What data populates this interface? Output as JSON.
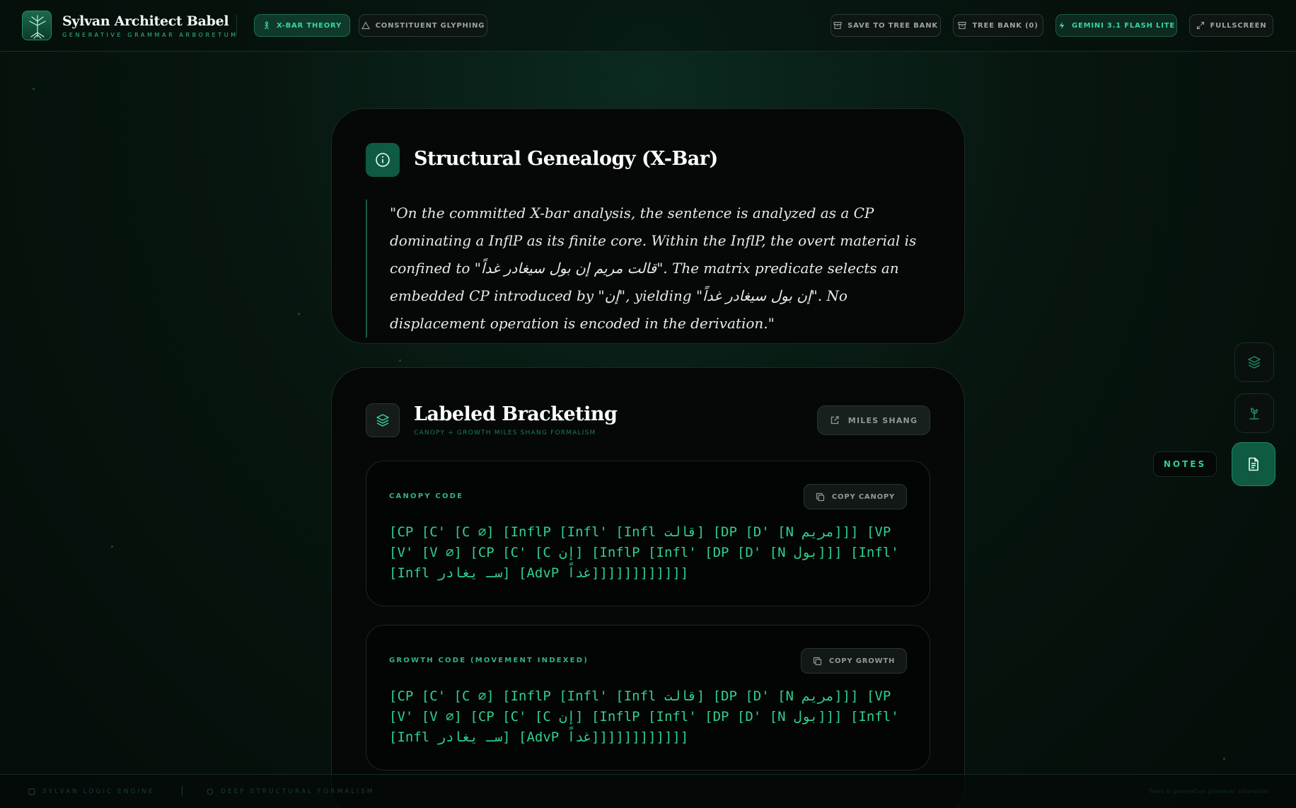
{
  "app": {
    "title": "Sylvan Architect Babel",
    "subtitle": "GENERATIVE GRAMMAR ARBORETUM"
  },
  "modes": {
    "xbar": "X-BAR THEORY",
    "glyphing": "CONSTITUENT GLYPHING"
  },
  "toolbar": {
    "save": "SAVE TO TREE BANK",
    "bank": "TREE BANK (0)",
    "model": "GEMINI 3.1 FLASH LITE",
    "fullscreen": "FULLSCREEN"
  },
  "genealogy": {
    "title": "Structural Genealogy (X-Bar)",
    "quote": "\"On the committed X-bar analysis, the sentence is analyzed as a CP dominating a InflP as its finite core. Within the InflP, the overt material is confined to \"قالت مريم إن بول سيغادر غداً\". The matrix predicate selects an embedded CP introduced by \"إن\", yielding \"إن بول سيغادر غداً\". No displacement operation is encoded in the derivation.\""
  },
  "bracketing": {
    "title": "Labeled Bracketing",
    "subtitle": "CANOPY + GROWTH MILES SHANG FORMALISM",
    "author_button": "MILES SHANG",
    "canopy": {
      "label": "CANOPY CODE",
      "copy": "COPY CANOPY",
      "code": "[CP [C' [C ∅] [InflP [Infl' [Infl قالت] [DP [D' [N مريم]]] [VP [V' [V ∅] [CP [C' [C إن] [InflP [Infl' [DP [D' [N بول]]] [Infl' [Infl سـ يغادر] [AdvP غداً]]]]]]]]]]]]"
    },
    "growth": {
      "label": "GROWTH CODE (MOVEMENT INDEXED)",
      "copy": "COPY GROWTH",
      "code": "[CP [C' [C ∅] [InflP [Infl' [Infl قالت] [DP [D' [N مريم]]] [VP [V' [V ∅] [CP [C' [C إن] [InflP [Infl' [DP [D' [N بول]]] [Infl' [Infl سـ يغادر] [AdvP غداً]]]]]]]]]]]]"
    }
  },
  "rail": {
    "notes_label": "NOTES"
  },
  "footer": {
    "engine": "SYLVAN LOGIC ENGINE",
    "formalism": "DEEP STRUCTURAL FORMALISM",
    "note": "Trees & generative grammar arboretum"
  },
  "colors": {
    "accent": "#2fd08f",
    "accent_dark": "#0f5a42",
    "background": "#06110c"
  }
}
